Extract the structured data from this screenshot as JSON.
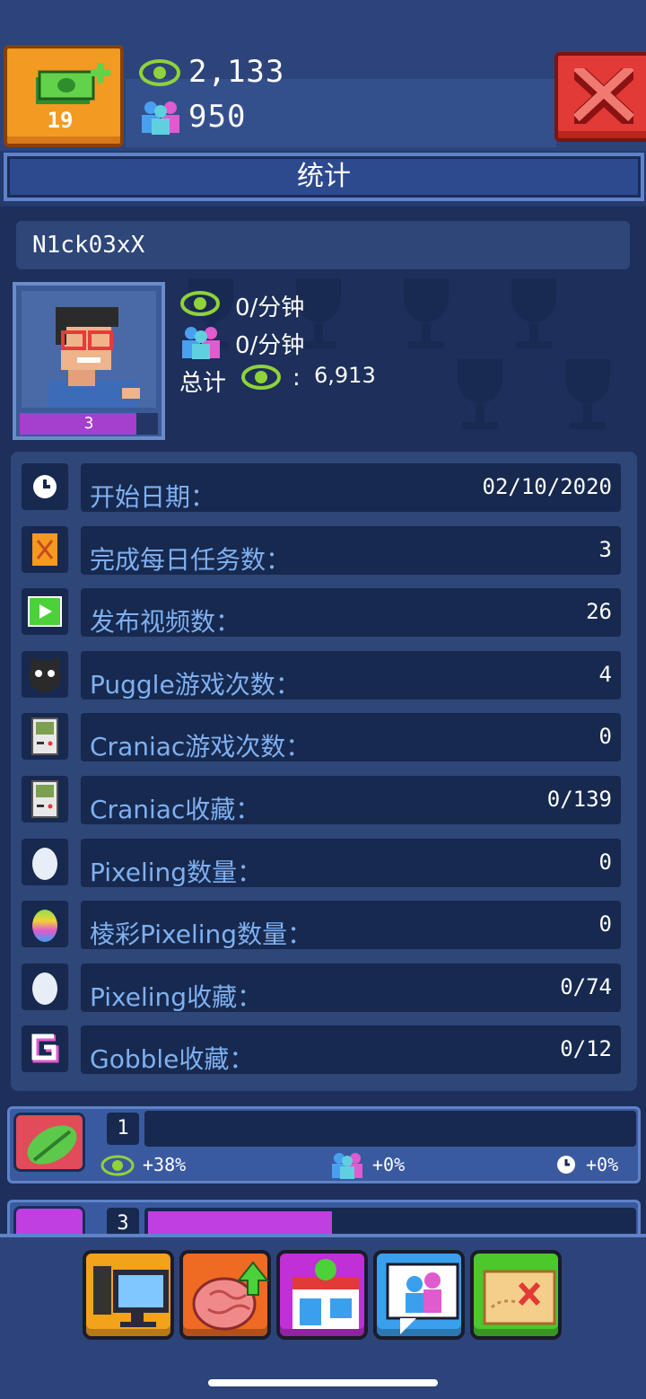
{
  "header": {
    "cash_count": "19",
    "views": "2,133",
    "subscribers": "950",
    "title": "统计"
  },
  "profile": {
    "username": "N1ck03xX",
    "level": "3",
    "views_rate": "0/分钟",
    "subs_rate": "0/分钟",
    "total_label": "总计",
    "total_sep": ":",
    "total_views": "6,913"
  },
  "stats": [
    {
      "icon": "clock-icon",
      "label": "开始日期：",
      "value": "02/10/2020"
    },
    {
      "icon": "map-icon",
      "label": "完成每日任务数：",
      "value": "3"
    },
    {
      "icon": "video-icon",
      "label": "发布视频数：",
      "value": "26"
    },
    {
      "icon": "puggle-icon",
      "label": "Puggle游戏次数：",
      "value": "4"
    },
    {
      "icon": "gameboy-icon",
      "label": "Craniac游戏次数：",
      "value": "0"
    },
    {
      "icon": "gameboy-icon",
      "label": "Craniac收藏：",
      "value": "0/139"
    },
    {
      "icon": "egg-icon",
      "label": "Pixeling数量：",
      "value": "0"
    },
    {
      "icon": "rainbow-egg-icon",
      "label": "棱彩Pixeling数量：",
      "value": "0"
    },
    {
      "icon": "egg-icon",
      "label": "Pixeling收藏：",
      "value": "0/74"
    },
    {
      "icon": "gobble-icon",
      "label": "Gobble收藏：",
      "value": "0/12"
    }
  ],
  "boosts": [
    {
      "level": "1",
      "progress": 0,
      "views_pct": "+38%",
      "subs_pct": "+0%",
      "time_pct": "+0%",
      "color": "#e14b5a"
    },
    {
      "level": "3",
      "progress": 0.38,
      "color": "#c03fe0"
    }
  ],
  "nav": [
    {
      "name": "studio",
      "color": "#f3a21c"
    },
    {
      "name": "brain",
      "color": "#ef6a22"
    },
    {
      "name": "shop",
      "color": "#c12fd6"
    },
    {
      "name": "social",
      "color": "#3aa0ee"
    },
    {
      "name": "map",
      "color": "#4cc72c"
    }
  ],
  "colors": {
    "background": "#253a6e",
    "panel": "#2e4678",
    "label": "#7fb0f0",
    "eye": "#8fd23a"
  }
}
